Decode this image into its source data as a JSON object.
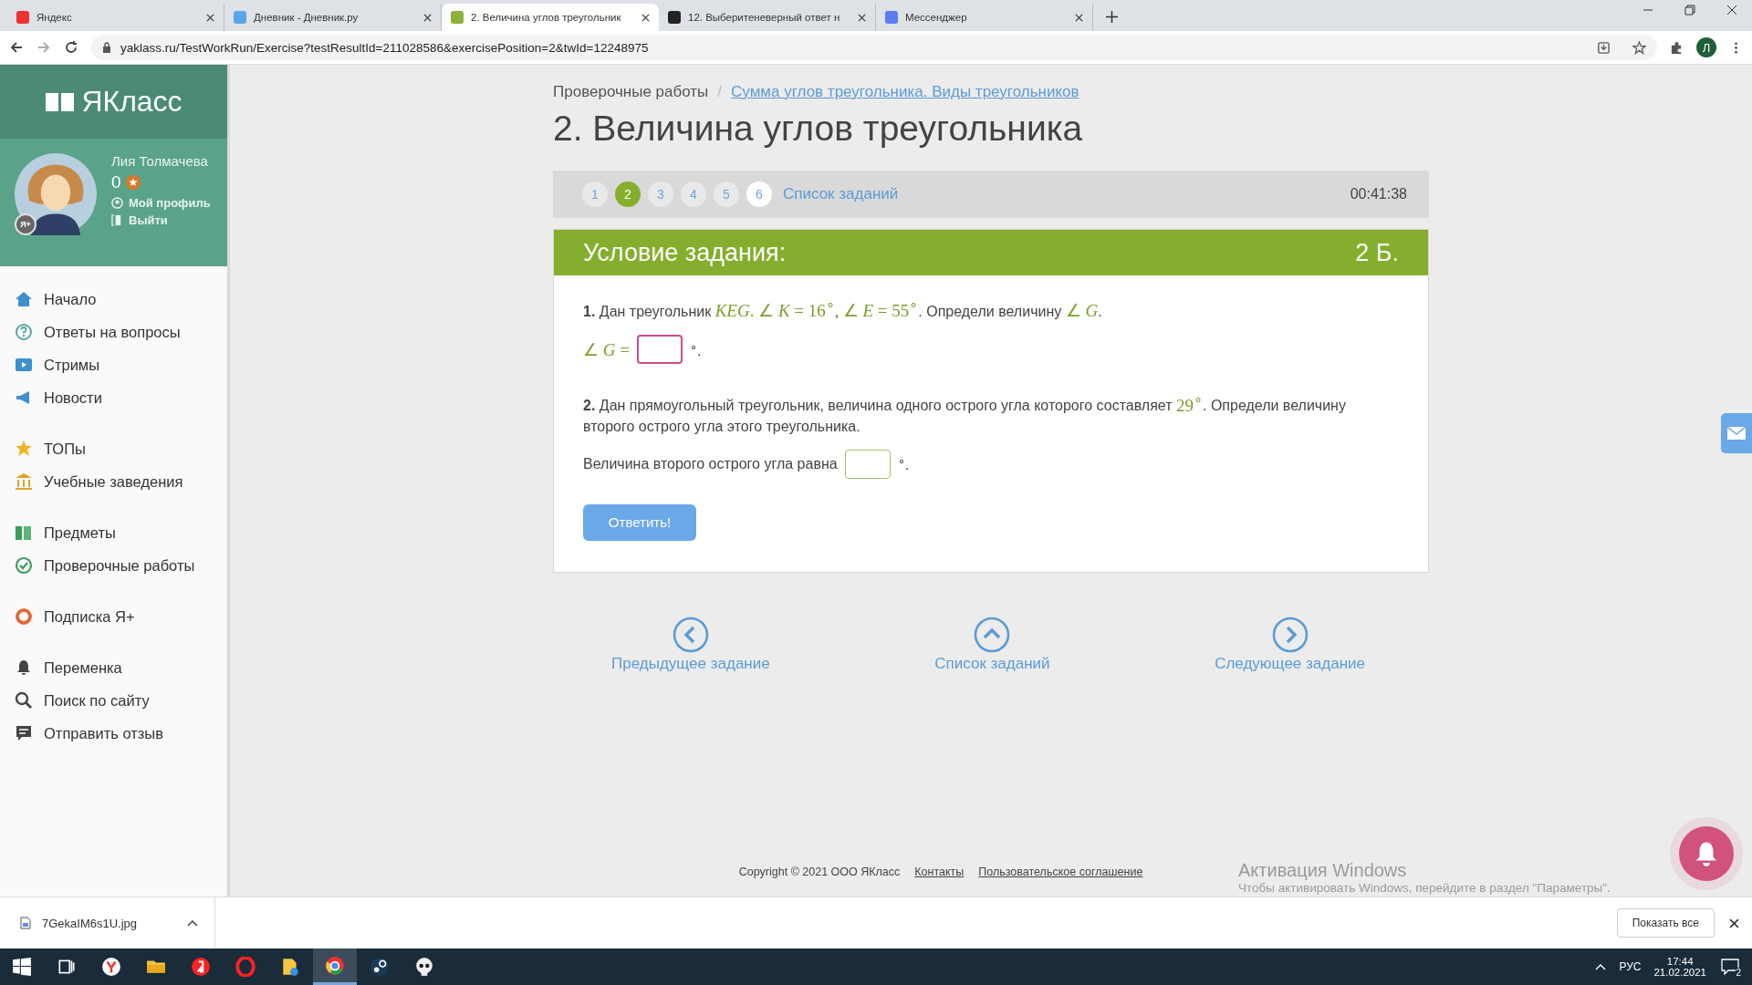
{
  "browser": {
    "tabs": [
      {
        "title": "Яндекс",
        "selected": false
      },
      {
        "title": "Дневник - Дневник.ру",
        "selected": false
      },
      {
        "title": "2. Величина углов треугольник",
        "selected": true
      },
      {
        "title": "12. Выберитеневерный ответ н",
        "selected": false
      },
      {
        "title": "Мессенджер",
        "selected": false
      }
    ],
    "address": "yaklass.ru/TestWorkRun/Exercise?testResultId=211028586&exercisePosition=2&twId=12248975",
    "profile_letter": "Л"
  },
  "sidebar": {
    "logo": "ЯКласс",
    "user": {
      "name": "Лия Толмачева",
      "badge": "Я+",
      "points": "0",
      "links": [
        "Мой профиль",
        "Выйти"
      ]
    },
    "groups": [
      [
        "Начало",
        "Ответы на вопросы",
        "Стримы",
        "Новости"
      ],
      [
        "ТОПы",
        "Учебные заведения"
      ],
      [
        "Предметы",
        "Проверочные работы"
      ],
      [
        "Подписка Я+"
      ],
      [
        "Переменка",
        "Поиск по сайту",
        "Отправить отзыв"
      ]
    ]
  },
  "breadcrumb": {
    "parent": "Проверочные работы",
    "separator": "/",
    "current": "Сумма углов треугольника. Виды треугольников"
  },
  "title": "2. Величина углов треугольника",
  "pager": {
    "pages": [
      {
        "label": "1",
        "selected": false,
        "answered": true
      },
      {
        "label": "2",
        "selected": true,
        "answered": true
      },
      {
        "label": "3",
        "selected": false,
        "answered": true
      },
      {
        "label": "4",
        "selected": false,
        "answered": true
      },
      {
        "label": "5",
        "selected": false,
        "answered": true
      },
      {
        "label": "6",
        "selected": false,
        "answered": false
      }
    ],
    "list_link": "Список заданий",
    "timer": "00:41:38"
  },
  "task": {
    "header": "Условие задания:",
    "points": "2 Б.",
    "questions": [
      {
        "text": [
          {
            "kind": "bold",
            "s": "1."
          },
          {
            "kind": "text",
            "s": " Дан треугольник "
          },
          {
            "kind": "math",
            "s": "*KEG*. ∠ *K* = 16$^{∘}$"
          },
          {
            "kind": "text",
            "s": ", "
          },
          {
            "kind": "math",
            "s": "∠ *E* = 55$^{∘}$"
          },
          {
            "kind": "text",
            "s": ". Определи величину "
          },
          {
            "kind": "math",
            "s": "∠ *G*"
          },
          {
            "kind": "text",
            "s": "."
          }
        ],
        "answer": {
          "before": "∠ *G* =",
          "kind": "math",
          "after": "$^{∘}$.",
          "focused": true
        }
      },
      {
        "text": [
          {
            "kind": "bold",
            "s": "2."
          },
          {
            "kind": "text",
            "s": " Дан прямоугольный треугольник, величина одного острого угла которого составляет "
          },
          {
            "kind": "math",
            "s": "29$^{∘}$"
          },
          {
            "kind": "text",
            "s": ". Определи величину второго острого угла этого треугольника."
          }
        ],
        "answer": {
          "before": "Величина второго острого угла равна",
          "kind": "text",
          "after": "$^{∘}$.",
          "focused": false
        }
      }
    ],
    "submit": "Ответить!"
  },
  "nav": [
    "Предыдущее задание",
    "Список заданий",
    "Следующее задание"
  ],
  "footer": {
    "copyright": "Copyright © 2021 ООО ЯКласс",
    "links": [
      "Контакты",
      "Пользовательское соглашение"
    ]
  },
  "windows_notice": {
    "title": "Активация Windows",
    "text": "Чтобы активировать Windows, перейдите в раздел \"Параметры\"."
  },
  "downloads": {
    "file": "7GekaIM6s1U.jpg",
    "show_all": "Показать все"
  },
  "taskbar": {
    "lang": "РУС",
    "time": "17:44",
    "date": "21.02.2021",
    "notifications": "2"
  }
}
